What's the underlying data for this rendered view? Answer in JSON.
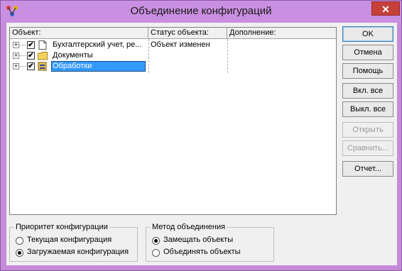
{
  "window": {
    "title": "Объединение конфигураций",
    "close_glyph": "✕",
    "accent_titlebar": "#c98fe0",
    "close_color": "#c7403a"
  },
  "grid": {
    "columns": [
      "Объект:",
      "Статус объекта:",
      "Дополнение:"
    ],
    "rows": [
      {
        "label": "Бухгалтерский учет, ре...",
        "status": "Объект изменен",
        "extra": "",
        "checked": true,
        "icon": "document-icon",
        "selected": false
      },
      {
        "label": "Документы",
        "status": "",
        "extra": "",
        "checked": true,
        "icon": "folder-icon",
        "selected": false
      },
      {
        "label": "Обработки",
        "status": "",
        "extra": "",
        "checked": true,
        "icon": "processing-icon",
        "selected": true
      }
    ],
    "expand_glyph": "+",
    "check_glyph": "✔"
  },
  "buttons": {
    "ok": "OK",
    "cancel": "Отмена",
    "help": "Помощь",
    "select_all": "Вкл. все",
    "deselect_all": "Выкл. все",
    "open": "Открыть",
    "compare": "Сравнить...",
    "report": "Отчет..."
  },
  "priority_group": {
    "title": "Приоритет конфигурации",
    "options": [
      "Текущая конфигурация",
      "Загружаемая конфигурация"
    ],
    "selected": 1
  },
  "merge_group": {
    "title": "Метод объединения",
    "options": [
      "Замещать объекты",
      "Объединять объекты"
    ],
    "selected": 0
  }
}
